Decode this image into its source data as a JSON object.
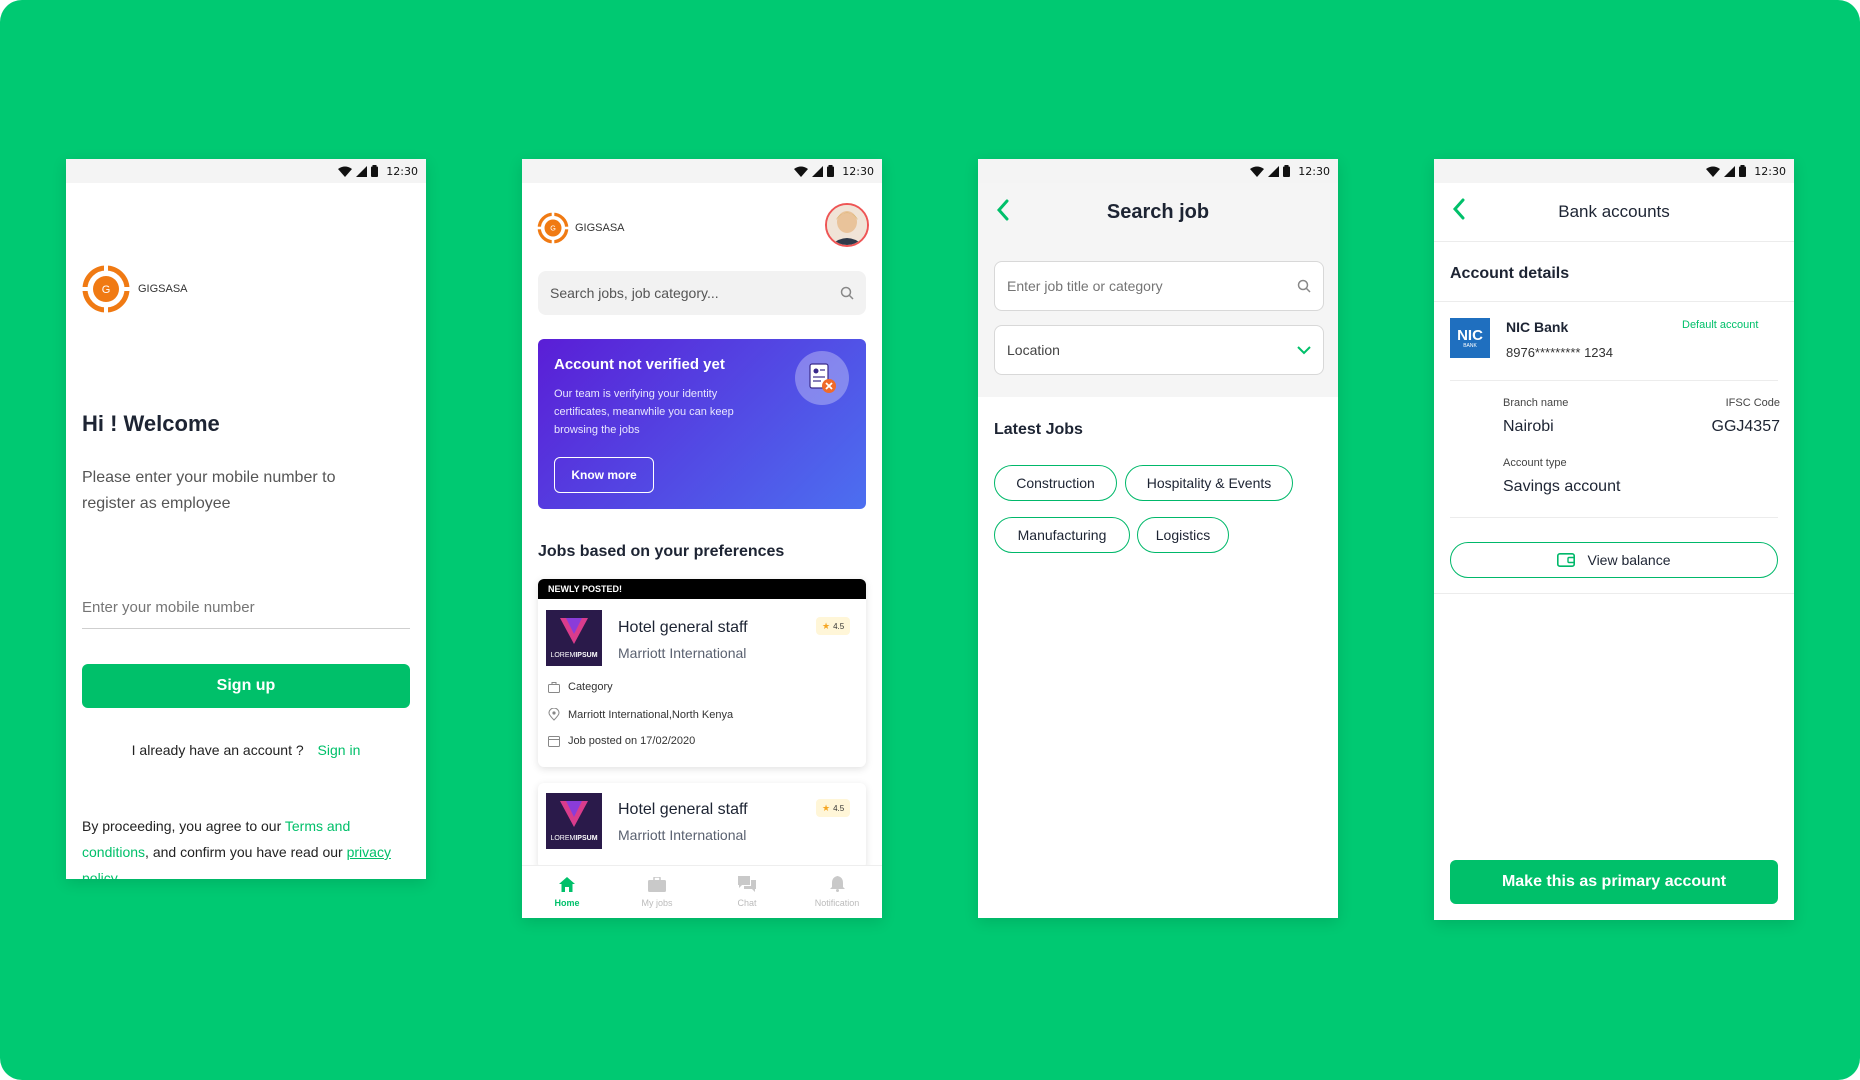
{
  "colors": {
    "background": "#00c972",
    "accent": "#00c06a",
    "dark": "#1d2433",
    "banner_start": "#5a1ed6",
    "banner_end": "#4c6ff0"
  },
  "status_time": "12:30",
  "brand": "GIGSASA",
  "screen1": {
    "heading": "Hi ! Welcome",
    "subtext": "Please enter your mobile number to register as employee",
    "mobile_placeholder": "Enter your mobile number",
    "signup_label": "Sign up",
    "have_account": "I already have an account ?",
    "signin_label": "Sign in",
    "terms_prefix": "By proceeding, you agree to our ",
    "terms_link": "Terms and conditions",
    "terms_mid": ", and confirm you have read our ",
    "privacy_link": "privacy policy"
  },
  "screen2": {
    "search_placeholder": "Search jobs, job category...",
    "banner": {
      "title": "Account not verified yet",
      "text": "Our team is verifying your identity certificates, meanwhile you can keep browsing the jobs",
      "button": "Know more"
    },
    "section_title": "Jobs based on your preferences",
    "new_badge": "NEWLY POSTED!",
    "jobs": [
      {
        "title": "Hotel general staff",
        "company": "Marriott International",
        "rating": "4.5",
        "category": "Category",
        "location": "Marriott International,North Kenya",
        "posted": "Job posted on 17/02/2020",
        "logo_top": "LOREM",
        "logo_bold": "IPSUM"
      },
      {
        "title": "Hotel general staff",
        "company": "Marriott International",
        "rating": "4.5",
        "logo_top": "LOREM",
        "logo_bold": "IPSUM"
      }
    ],
    "nav": [
      {
        "label": "Home",
        "icon": "home-icon"
      },
      {
        "label": "My jobs",
        "icon": "briefcase-icon"
      },
      {
        "label": "Chat",
        "icon": "chat-icon"
      },
      {
        "label": "Notification",
        "icon": "bell-icon"
      }
    ]
  },
  "screen3": {
    "title": "Search job",
    "job_placeholder": "Enter job title or category",
    "location_placeholder": "Location",
    "latest_title": "Latest Jobs",
    "tags": [
      "Construction",
      "Hospitality & Events",
      "Manufacturing",
      "Logistics"
    ]
  },
  "screen4": {
    "title": "Bank accounts",
    "section_title": "Account details",
    "bank_logo": "NIC",
    "bank_logo_sub": "BANK",
    "bank_name": "NIC Bank",
    "default_label": "Default account",
    "account_number": "8976********* 1234",
    "branch_label": "Branch name",
    "branch_value": "Nairobi",
    "ifsc_label": "IFSC Code",
    "ifsc_value": "GGJ4357",
    "type_label": "Account type",
    "type_value": "Savings account",
    "view_balance": "View balance",
    "primary_button": "Make this as primary account"
  }
}
